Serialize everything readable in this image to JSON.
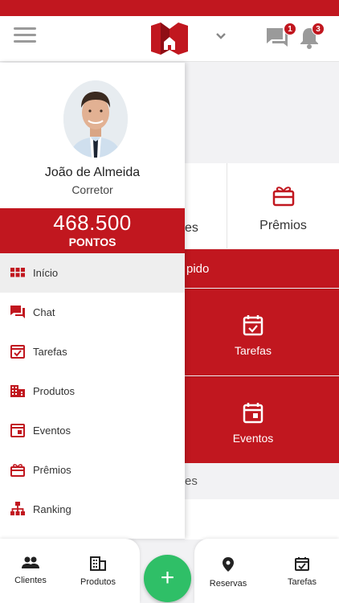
{
  "header": {
    "chat_badge": "1",
    "notifications_badge": "3"
  },
  "user": {
    "name": "João de Almeida",
    "role": "Corretor",
    "points_value": "468.500",
    "points_label": "PONTOS"
  },
  "menu": [
    {
      "label": "Início",
      "icon": "grid-icon",
      "active": true
    },
    {
      "label": "Chat",
      "icon": "chat-icon"
    },
    {
      "label": "Tarefas",
      "icon": "calendar-check-icon"
    },
    {
      "label": "Produtos",
      "icon": "building-icon"
    },
    {
      "label": "Eventos",
      "icon": "calendar-event-icon"
    },
    {
      "label": "Prêmios",
      "icon": "gift-icon"
    },
    {
      "label": "Ranking",
      "icon": "hierarchy-icon"
    }
  ],
  "background": {
    "tile_left_partial": "es",
    "tile_premios": "Prêmios",
    "quick_band_partial": "pido",
    "tile_tarefas": "Tarefas",
    "tile_eventos": "Eventos",
    "section_partial": "es"
  },
  "bottom_nav": {
    "clientes": "Clientes",
    "produtos": "Produtos",
    "add": "+",
    "reservas": "Reservas",
    "tarefas": "Tarefas"
  },
  "colors": {
    "brand_red": "#c1171f",
    "fab_green": "#2fbf67"
  }
}
